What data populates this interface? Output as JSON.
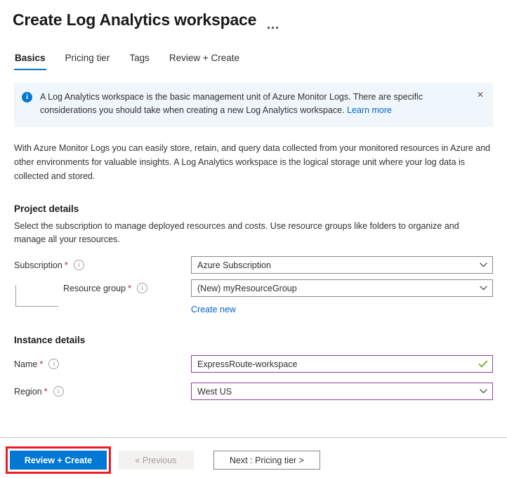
{
  "header": {
    "title": "Create Log Analytics workspace",
    "more_menu": "…"
  },
  "tabs": [
    {
      "label": "Basics",
      "active": true
    },
    {
      "label": "Pricing tier",
      "active": false
    },
    {
      "label": "Tags",
      "active": false
    },
    {
      "label": "Review + Create",
      "active": false
    }
  ],
  "banner": {
    "icon": "info-icon",
    "text": "A Log Analytics workspace is the basic management unit of Azure Monitor Logs. There are specific considerations you should take when creating a new Log Analytics workspace.",
    "link_label": "Learn more",
    "close_label": "✕"
  },
  "intro": {
    "paragraph": "With Azure Monitor Logs you can easily store, retain, and query data collected from your monitored resources in Azure and other environments for valuable insights. A Log Analytics workspace is the logical storage unit where your log data is collected and stored."
  },
  "project_details": {
    "title": "Project details",
    "description": "Select the subscription to manage deployed resources and costs. Use resource groups like folders to organize and manage all your resources.",
    "subscription": {
      "label": "Subscription",
      "required": "*",
      "value": "Azure Subscription"
    },
    "resource_group": {
      "label": "Resource group",
      "required": "*",
      "value": "(New) myResourceGroup",
      "create_new_label": "Create new"
    }
  },
  "instance_details": {
    "title": "Instance details",
    "name": {
      "label": "Name",
      "required": "*",
      "value": "ExpressRoute-workspace"
    },
    "region": {
      "label": "Region",
      "required": "*",
      "value": "West US"
    }
  },
  "footer": {
    "review_create_label": "Review + Create",
    "previous_label": "« Previous",
    "next_label": "Next : Pricing tier >"
  },
  "colors": {
    "accent_blue": "#0078d4",
    "link_blue": "#0066cc",
    "banner_bg": "#eff6fc",
    "required_red": "#a4262c",
    "highlight_red": "#ed1c24",
    "focus_purple": "#8e3f9e",
    "success_green": "#5aa700"
  }
}
